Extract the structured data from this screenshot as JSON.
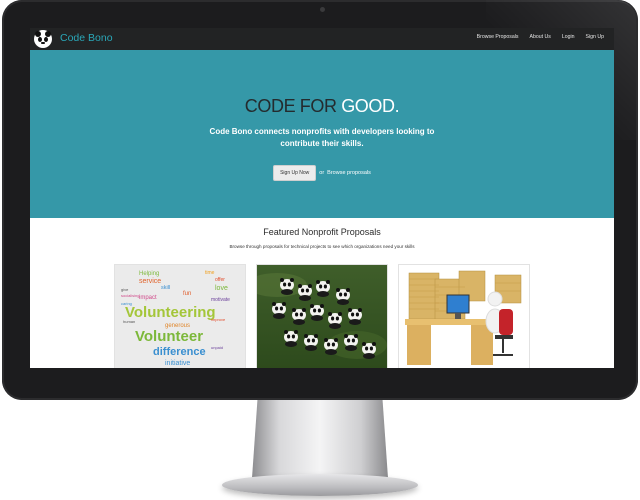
{
  "nav": {
    "brand": "Code Bono",
    "links": [
      "Browse Proposals",
      "About Us",
      "Login",
      "Sign Up"
    ]
  },
  "hero": {
    "title_part1": "CODE FOR ",
    "title_part2": "GOOD.",
    "subtitle": "Code Bono connects nonprofits with developers looking to contribute their skills.",
    "signup_button": "Sign Up Now",
    "or_text": "or",
    "browse_link": "Browse proposals"
  },
  "featured": {
    "title": "Featured Nonprofit Proposals",
    "subtitle": "Browse through proposals for technical projects to see which organizations need your skills"
  },
  "wordcloud": {
    "words": [
      "Helping",
      "time",
      "offer",
      "service",
      "skill",
      "love",
      "fun",
      "impact",
      "motivate",
      "Volunteering",
      "generous",
      "Volunteer",
      "difference",
      "initiative",
      "give",
      "improve",
      "human",
      "caring",
      "socialising",
      "unpaid"
    ]
  },
  "colors": {
    "navbar": "#222324",
    "brand": "#2aa7b8",
    "hero_bg": "#3598a8",
    "hero_dark_text": "#242b2e"
  },
  "icons": {
    "logo": "panda-face-icon"
  }
}
